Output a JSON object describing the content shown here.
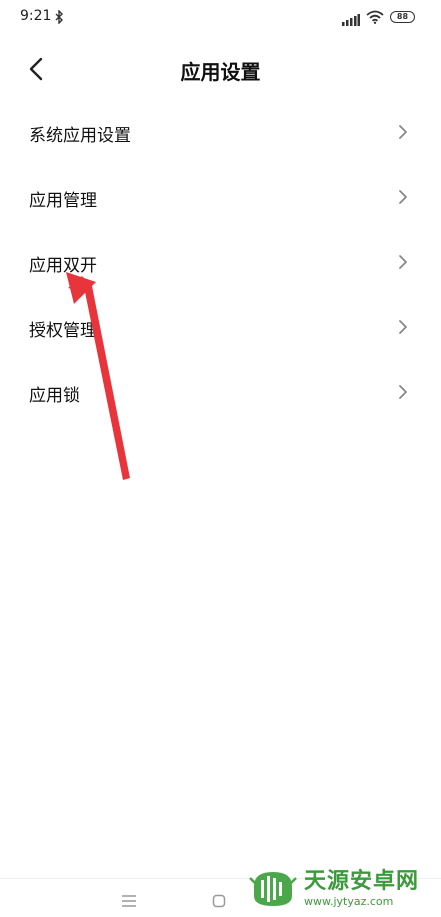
{
  "status_bar": {
    "time": "9:21",
    "battery": "88",
    "icons": [
      "bluetooth-icon",
      "signal-icon",
      "wifi-icon",
      "battery-icon"
    ]
  },
  "header": {
    "title": "应用设置",
    "back_icon": "back-chevron-icon"
  },
  "settings": {
    "items": [
      {
        "label": "系统应用设置"
      },
      {
        "label": "应用管理"
      },
      {
        "label": "应用双开"
      },
      {
        "label": "授权管理"
      },
      {
        "label": "应用锁"
      }
    ],
    "chevron_icon": "chevron-right-icon"
  },
  "annotation": {
    "color": "#e8353b",
    "target": "应用双开"
  },
  "nav_bar": {
    "icons": [
      "menu-icon",
      "home-icon"
    ]
  },
  "watermark": {
    "title": "天源安卓网",
    "url": "www.jytyaz.com",
    "color": "#3c9a3c"
  },
  "colors": {
    "background": "#ffffff",
    "text": "#111111",
    "chevron": "#888888"
  }
}
